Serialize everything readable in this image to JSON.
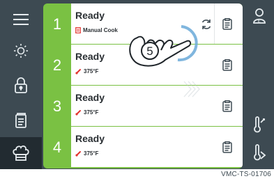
{
  "rows": [
    {
      "number": "1",
      "status": "Ready",
      "detail": "Manual Cook",
      "detail_icon": "manual-cook-icon",
      "has_refresh": true
    },
    {
      "number": "2",
      "status": "Ready",
      "detail": "375°F",
      "detail_icon": "thermometer-icon",
      "has_refresh": false
    },
    {
      "number": "3",
      "status": "Ready",
      "detail": "375°F",
      "detail_icon": "thermometer-icon",
      "has_refresh": false
    },
    {
      "number": "4",
      "status": "Ready",
      "detail": "375°F",
      "detail_icon": "thermometer-icon",
      "has_refresh": false
    }
  ],
  "left_rail": [
    "menu-icon",
    "brightness-icon",
    "lock-icon",
    "recipe-book-icon",
    "chef-hat-icon"
  ],
  "right_rail": [
    "user-profile-icon",
    "probe-temp-icon",
    "probe-icon"
  ],
  "callout": {
    "label": "5"
  },
  "caption": "VMC-TS-01706",
  "colors": {
    "frame": "#3d4a52",
    "accent": "#7ac143",
    "active_rail": "#222b31",
    "callout_ring": "#6aa9d8"
  }
}
